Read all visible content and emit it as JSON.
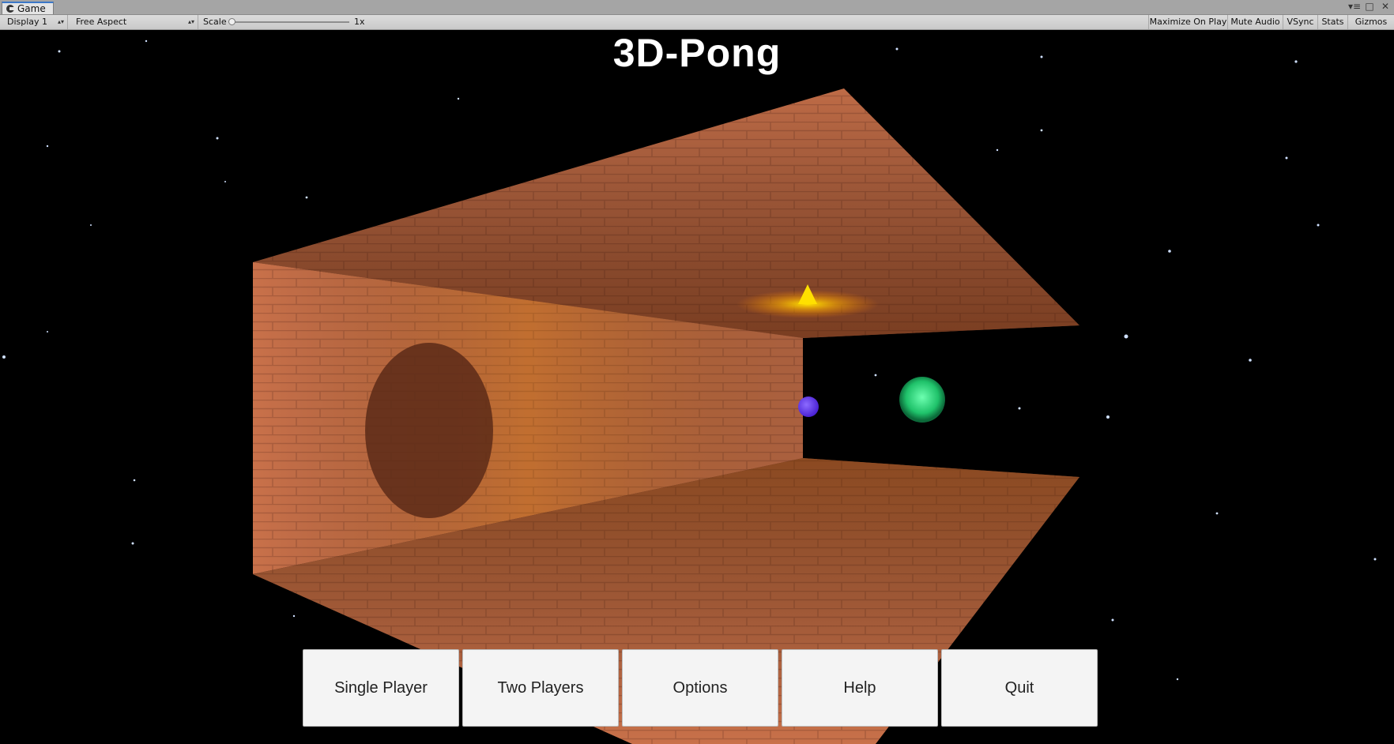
{
  "editor": {
    "tab_label": "Game",
    "window_controls": [
      "▾≡",
      "□",
      "✕"
    ]
  },
  "toolbar": {
    "display": "Display 1",
    "aspect": "Free Aspect",
    "scale_label": "Scale",
    "scale_value": "1x",
    "scale_fraction": 0.0,
    "maximize_on_play": "Maximize On Play",
    "mute_audio": "Mute Audio",
    "vsync": "VSync",
    "stats": "Stats",
    "gizmos": "Gizmos"
  },
  "game": {
    "title": "3D-Pong",
    "menu": {
      "single_player": "Single Player",
      "two_players": "Two Players",
      "options": "Options",
      "help": "Help",
      "quit": "Quit"
    },
    "colors": {
      "brick": "#c9714a",
      "ball": "#6a3cf2",
      "paddle": "#21d67a",
      "light": "#ffd200",
      "space": "#000000"
    }
  }
}
